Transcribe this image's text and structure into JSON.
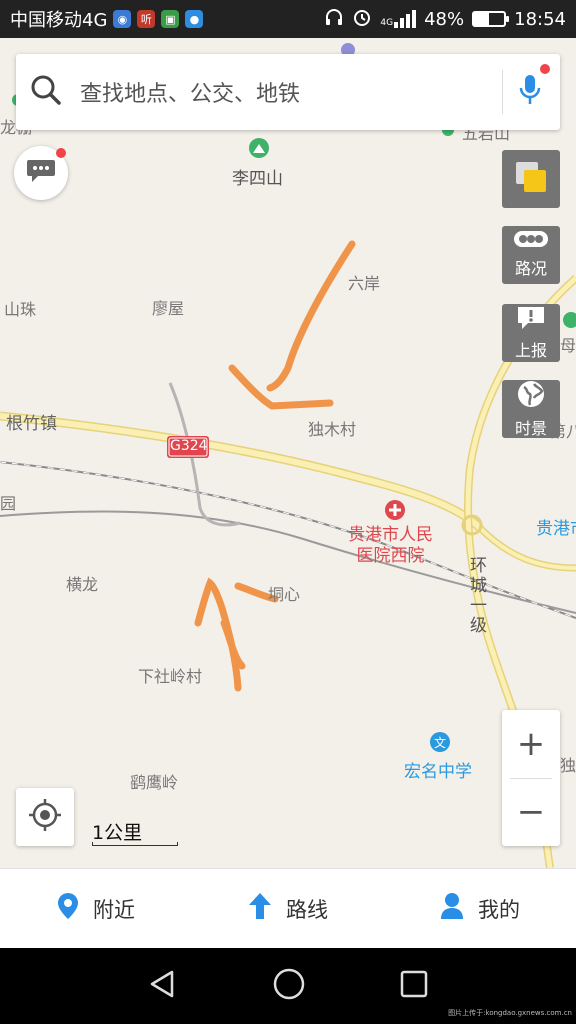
{
  "status_bar": {
    "carrier": "中国移动4G",
    "network": "4G",
    "battery_percent": "48%",
    "battery_level": 0.48,
    "time": "18:54",
    "apps": [
      {
        "name": "location-app-icon",
        "color": "#3b7bd6",
        "glyph": "◉"
      },
      {
        "name": "listen-app-icon",
        "color": "#c0392b",
        "glyph": "听"
      },
      {
        "name": "green-app-icon",
        "color": "#3a9b48",
        "glyph": "▣"
      },
      {
        "name": "chat-app-icon",
        "color": "#2f8de0",
        "glyph": "●"
      }
    ]
  },
  "search": {
    "placeholder": "查找地点、公交、地铁"
  },
  "map": {
    "labels": {
      "lisishan": "李四山",
      "liuan": "六岸",
      "shanzhu": "山珠",
      "liaowu": "廖屋",
      "genzhuzhen": "根竹镇",
      "dumucun": "独木村",
      "hospital": "贵港市人民\n医院西院",
      "guigang": "贵港市",
      "henglong": "横龙",
      "tongxin": "垌心",
      "xiasheling": "下社岭村",
      "huancheng": "环\n城\n一\n级",
      "hongming": "宏名中学",
      "yingying": "鹞鹰岭",
      "road_g324": "G324",
      "longpeng": "龙棚",
      "wuyanshan": "五岩山",
      "dumu2": "独母",
      "di8": "第八",
      "yuan": "园",
      "du_right": "独"
    }
  },
  "side_buttons": {
    "layers": "",
    "traffic": "路况",
    "report": "上报",
    "realtime": "时景"
  },
  "zoom": {
    "in": "+",
    "out": "−"
  },
  "scale": {
    "label": "1公里"
  },
  "bottom_nav": {
    "nearby": "附近",
    "route": "路线",
    "mine": "我的"
  },
  "watermark": "图片上传于:kongdao.gxnews.com.cn",
  "colors": {
    "accent_blue": "#2a8de6",
    "red": "#e0464d",
    "road_yellow": "#f8e89a",
    "annotation_orange": "#f0944a"
  }
}
